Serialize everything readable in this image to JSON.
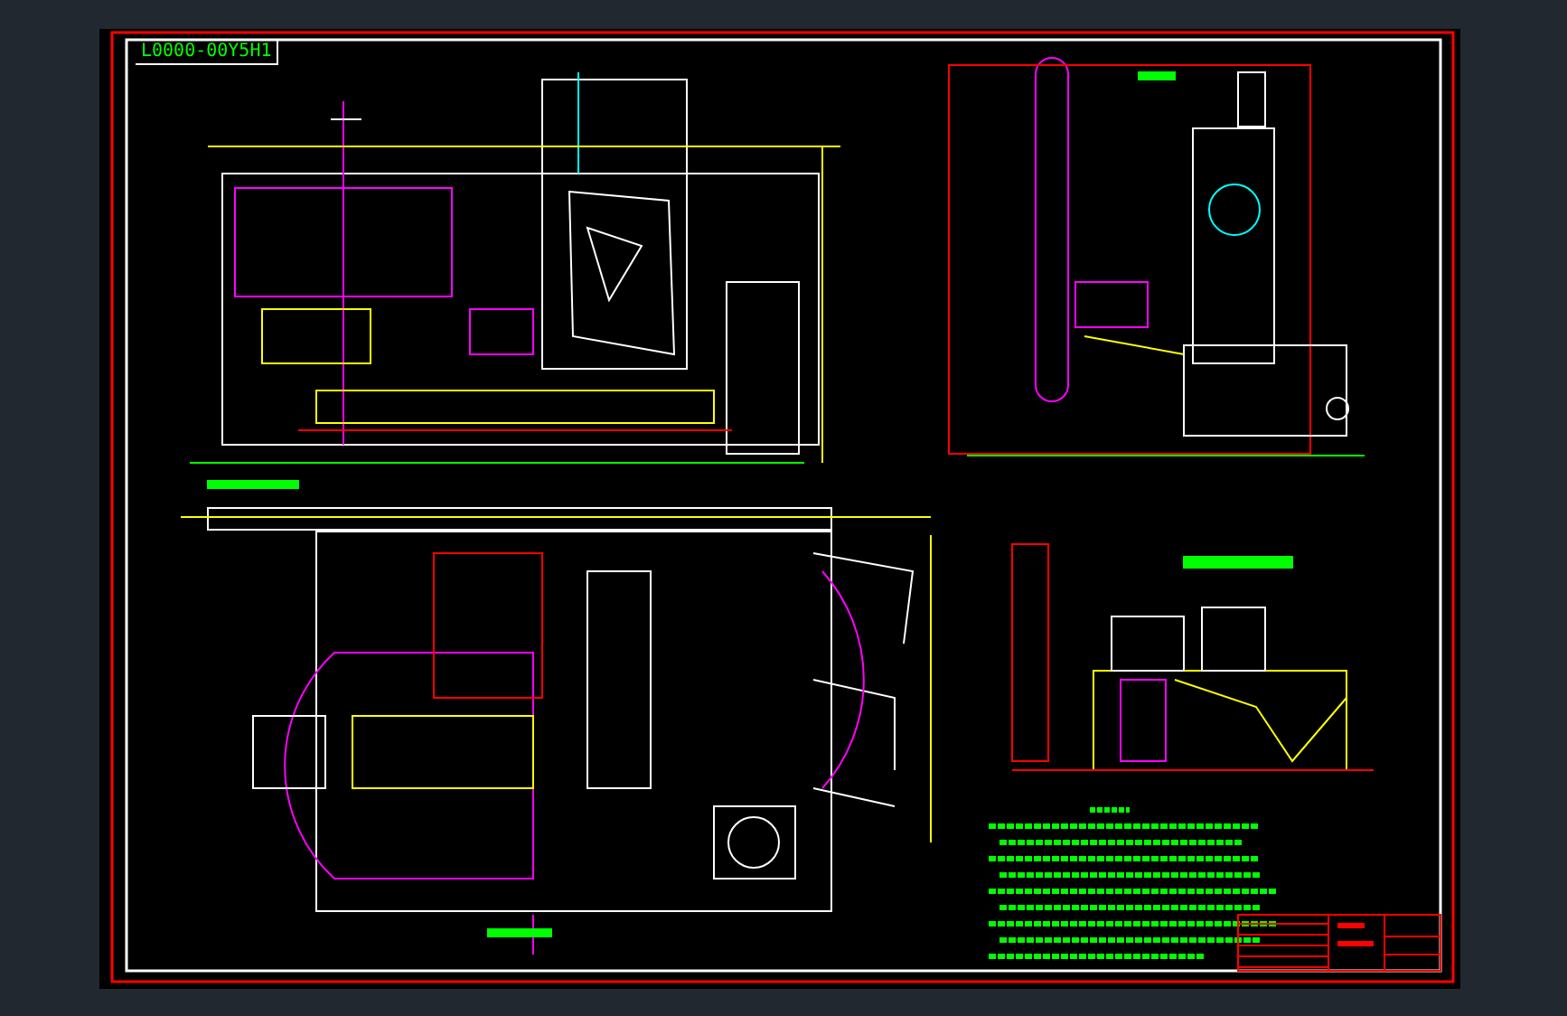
{
  "sheet": {
    "code_label": "L0000-00Y5H1"
  }
}
